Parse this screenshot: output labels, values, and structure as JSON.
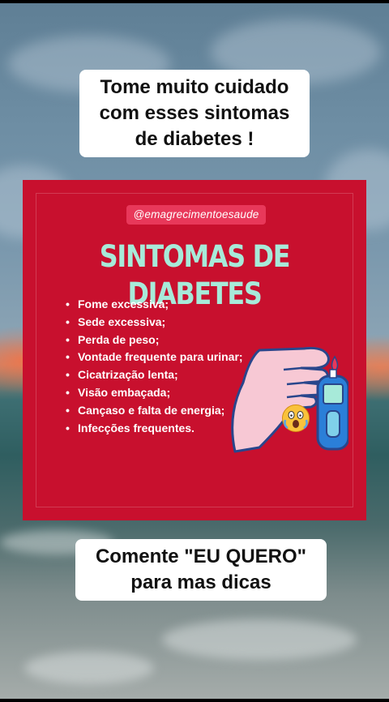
{
  "caption_top": {
    "lines": [
      "Tome muito cuidado",
      "com esses sintomas",
      "de diabetes !"
    ]
  },
  "card": {
    "handle": "@emagrecimentoesaude",
    "title": "SINTOMAS DE DIABETES",
    "symptoms": [
      "Fome excessiva;",
      "Sede excessiva;",
      "Perda de peso;",
      "Vontade frequente para urinar;",
      "Cicatrização lenta;",
      "Visão embaçada;",
      "Cançaso  e falta de energia;",
      "Infecções frequentes."
    ],
    "illustration_icon": "finger-prick-glucose-meter-icon",
    "emoji_icon": "screaming-face-emoji"
  },
  "caption_bottom": {
    "lines": [
      "Comente \"EU QUERO\"",
      "para mas dicas"
    ]
  },
  "colors": {
    "card_red": "#c8102e",
    "title_mint": "#a7ead9",
    "handle_pink": "#e8385a"
  }
}
